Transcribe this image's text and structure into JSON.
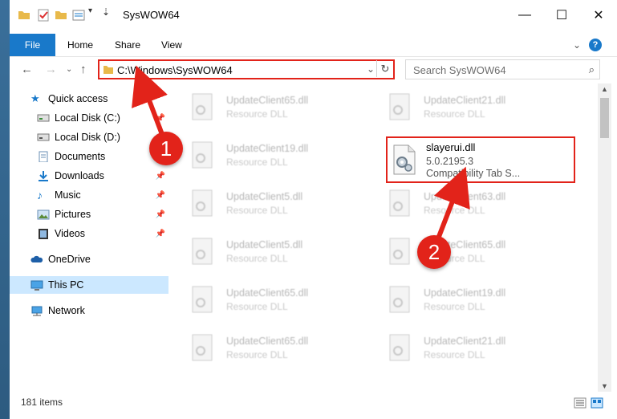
{
  "window": {
    "title": "SysWOW64",
    "minimize_glyph": "—",
    "maximize_glyph": "☐",
    "close_glyph": "✕"
  },
  "ribbon": {
    "tabs": [
      "File",
      "Home",
      "Share",
      "View"
    ],
    "help_glyph": "?"
  },
  "address": {
    "path": "C:\\Windows\\SysWOW64",
    "search_placeholder": "Search SysWOW64"
  },
  "nav": {
    "items": [
      {
        "label": "Quick access",
        "icon": "star-icon"
      },
      {
        "label": "Local Disk (C:)",
        "icon": "drive-icon"
      },
      {
        "label": "Local Disk (D:)",
        "icon": "drive-icon"
      },
      {
        "label": "Documents",
        "icon": "documents-icon"
      },
      {
        "label": "Downloads",
        "icon": "download-icon"
      },
      {
        "label": "Music",
        "icon": "music-icon"
      },
      {
        "label": "Pictures",
        "icon": "pictures-icon"
      },
      {
        "label": "Videos",
        "icon": "videos-icon"
      },
      {
        "label": "OneDrive",
        "icon": "cloud-icon"
      },
      {
        "label": "This PC",
        "icon": "computer-icon"
      },
      {
        "label": "Network",
        "icon": "network-icon"
      }
    ]
  },
  "files": {
    "col1": [
      "UpdateClient65.dll",
      "UpdateClient19.dll",
      "UpdateClient5.dll",
      "UpdateClient5.dll",
      "UpdateClient65.dll",
      "UpdateClient65.dll"
    ],
    "col2": [
      "UpdateClient21.dll",
      "UpdateClient63.dll",
      "UpdateClient65.dll",
      "UpdateClient19.dll",
      "UpdateClient21.dll"
    ],
    "type": "Resource DLL"
  },
  "highlighted_file": {
    "name": "slayerui.dll",
    "version": "5.0.2195.3",
    "description": "Compatibility Tab S..."
  },
  "status": {
    "item_count": "181 items"
  },
  "callouts": [
    "1",
    "2"
  ],
  "colors": {
    "accent": "#1979ca",
    "highlight": "#e2231a"
  }
}
